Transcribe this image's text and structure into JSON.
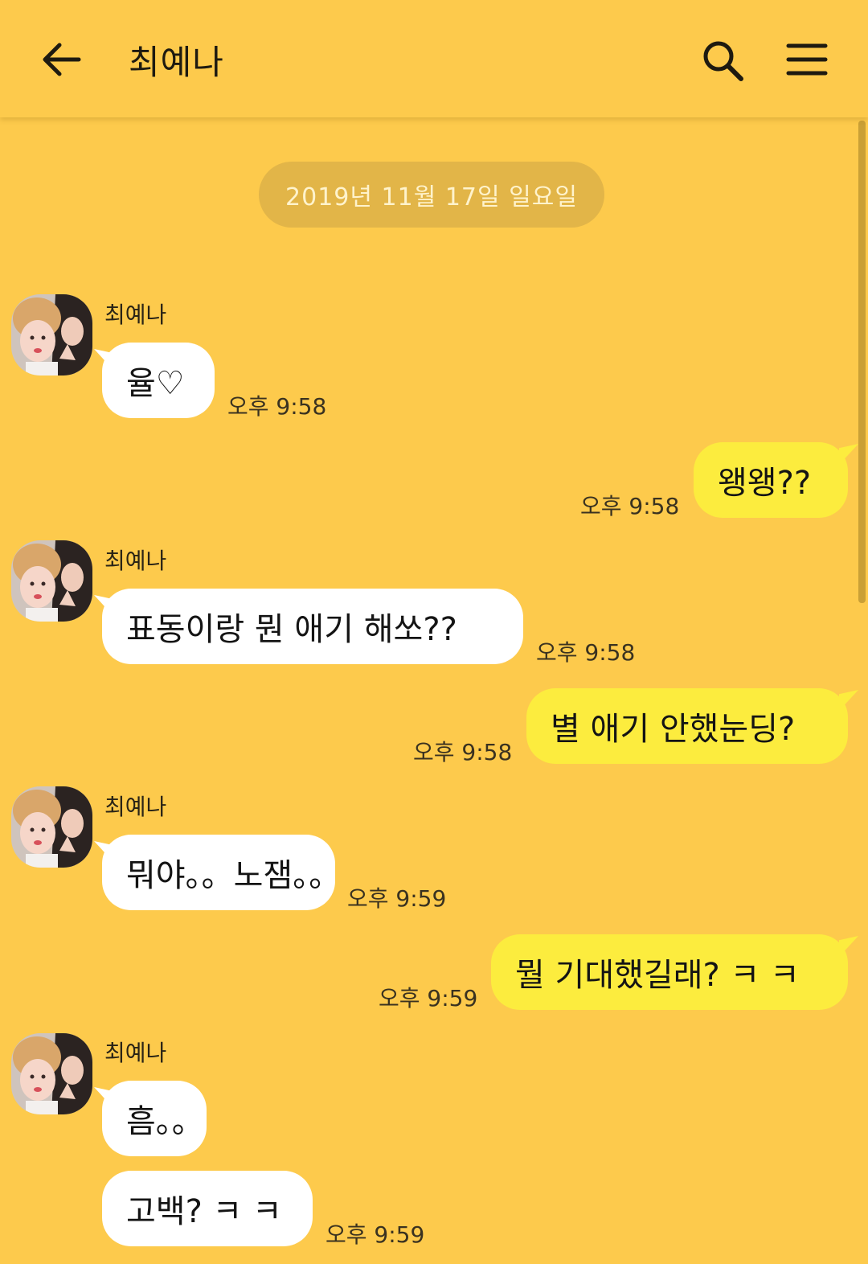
{
  "header": {
    "title": "최예나"
  },
  "date_divider": "2019년 11월 17일 일요일",
  "colors": {
    "background": "#fdca4c",
    "incoming_bubble": "#ffffff",
    "outgoing_bubble": "#fcec3e",
    "date_pill": "#e2b548"
  },
  "messages": [
    {
      "direction": "in",
      "sender": "최예나",
      "text": "율♡",
      "time": "오후 9:58"
    },
    {
      "direction": "out",
      "text": "왱왱??",
      "time": "오후 9:58"
    },
    {
      "direction": "in",
      "sender": "최예나",
      "text": "표동이랑 뭔 애기 해쏘??",
      "time": "오후 9:58"
    },
    {
      "direction": "out",
      "text": "별 애기 안했눈딩?",
      "time": "오후 9:58"
    },
    {
      "direction": "in",
      "sender": "최예나",
      "text": "뭐야。。노잼。。",
      "time": "오후 9:59"
    },
    {
      "direction": "out",
      "text": "뭘 기대했길래? ㅋ ㅋ",
      "time": "오후 9:59"
    },
    {
      "direction": "in",
      "sender": "최예나",
      "text": "흠。。",
      "time": ""
    },
    {
      "direction": "in",
      "text": "고백? ㅋ ㅋ",
      "time": "오후 9:59"
    }
  ]
}
